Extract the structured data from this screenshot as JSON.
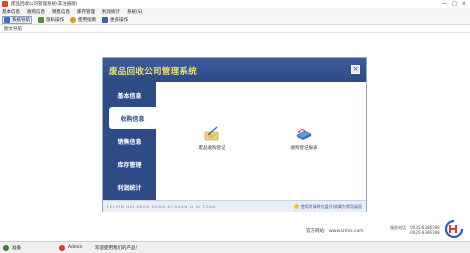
{
  "window": {
    "title": "废品回收公司管理系统(非注册版)",
    "controls": [
      "—",
      "□",
      "×"
    ]
  },
  "menubar": {
    "items": [
      "基本信息",
      "收购信息",
      "销售信息",
      "库存管理",
      "利润统计",
      "系统(S)"
    ]
  },
  "toolbar": {
    "items": [
      {
        "label": "系统导航",
        "icon": "home-icon",
        "color": "#3a6fd0"
      },
      {
        "label": "隐私操作",
        "icon": "lock-icon",
        "color": "#5b8f3a"
      },
      {
        "label": "使用指南",
        "icon": "help-icon",
        "color": "#d8a020"
      },
      {
        "label": "更多操作",
        "icon": "more-icon",
        "color": "#4060a0"
      }
    ]
  },
  "tabstrip": {
    "active_tab": "图文导航"
  },
  "panel": {
    "title": "废品回收公司管理系统",
    "close_label": "×",
    "sidebar": [
      "基本信息",
      "收购信息",
      "销售信息",
      "库存管理",
      "利润统计"
    ],
    "active_index": 1,
    "tiles": [
      {
        "label": "废品收购登记",
        "icon": "edit-icon"
      },
      {
        "label": "收购登记报表",
        "icon": "report-icon"
      }
    ],
    "footer_pinyin": "FEI PIN HUI SHOU GONG SI GUAN LI XI TONG",
    "footer_hint": "使用时请将光盘开/收藏为常用桌面"
  },
  "site": {
    "label": "官方网站:",
    "url": "www.lzmis.com"
  },
  "phone": {
    "label": "服务电话",
    "numbers": [
      "0635-8386398",
      "0635-8386398"
    ]
  },
  "statusbar": {
    "segments": [
      {
        "label": "准备",
        "color": "#3a7d3a"
      },
      {
        "label": "Admin",
        "color": "#c0452c"
      },
      {
        "label": "欢迎使用我们的产品!",
        "color": ""
      }
    ]
  },
  "colors": {
    "panel_header": "#2d4a86",
    "sidebar": "#2e4b86",
    "title_text": "#f3e06c"
  }
}
